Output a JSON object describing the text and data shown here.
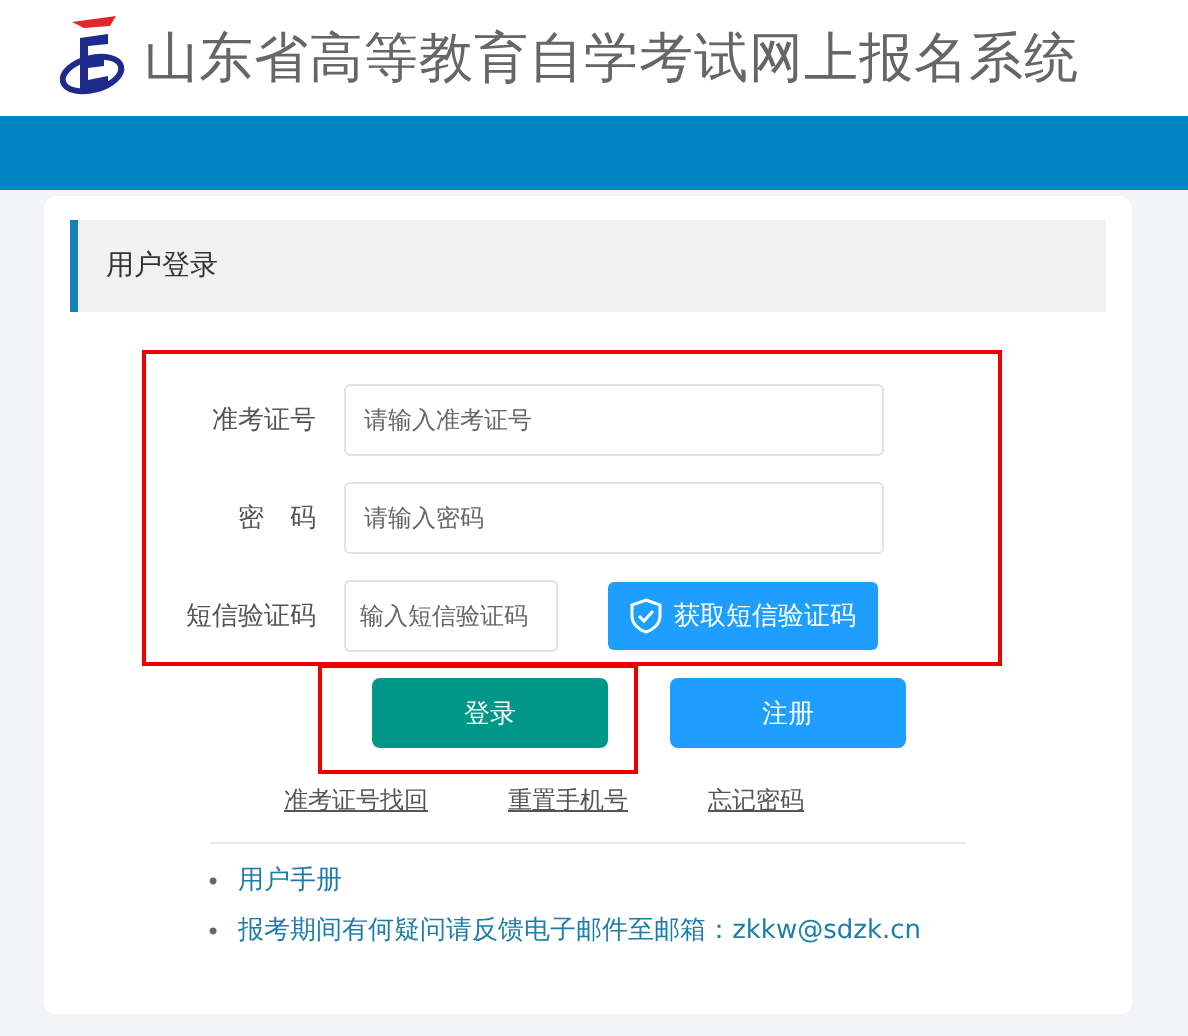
{
  "header": {
    "title": "山东省高等教育自学考试网上报名系统"
  },
  "panel": {
    "title": "用户登录"
  },
  "fields": [
    {
      "kind": "text",
      "label": "准考证号",
      "placeholder": "请输入准考证号"
    },
    {
      "kind": "text",
      "label": "密　码",
      "placeholder": "请输入密码"
    },
    {
      "kind": "sms",
      "label": "短信验证码",
      "placeholder": "输入短信验证码",
      "button": "获取短信验证码"
    }
  ],
  "buttons": [
    {
      "label": "登录",
      "kind": "primary"
    },
    {
      "label": "注册",
      "kind": "secondary"
    }
  ],
  "links": [
    "准考证号找回",
    "重置手机号",
    "忘记密码"
  ],
  "notes": [
    {
      "bullet": "•",
      "text": "用户手册"
    },
    {
      "bullet": "•",
      "text": "报考期间有何疑问请反馈电子邮件至邮箱：zkkw@sdzk.cn"
    }
  ]
}
